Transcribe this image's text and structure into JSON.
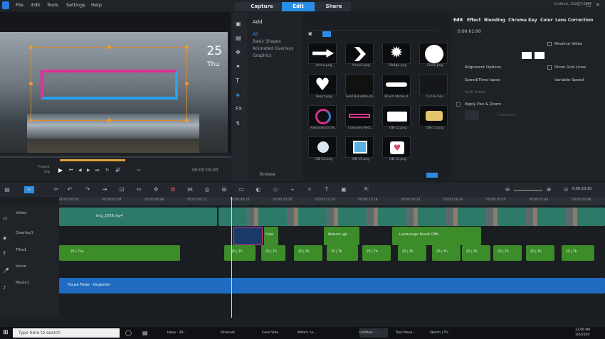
{
  "menu": {
    "file": "File",
    "edit": "Edit",
    "tools": "Tools",
    "settings": "Settings",
    "help": "Help"
  },
  "modes": {
    "capture": "Capture",
    "edit": "Edit",
    "share": "Share"
  },
  "window": {
    "title": "Untitled, 1920*1080*"
  },
  "preview": {
    "big_date": "25",
    "big_day": "Thu",
    "project_label": "Project",
    "clip_label": "Clip",
    "timecode": "00:00:00:00"
  },
  "library": {
    "add": "Add",
    "categories": [
      "All",
      "Basic Shapes",
      "Animated Overlays",
      "Graphics"
    ],
    "browse": "Browse",
    "thumbs": [
      "Arrow.png",
      "Arrow2.png",
      "Badge.png",
      "Circle.png",
      "Heart.png",
      "Gold Bokehbrush...",
      "Brush Stroke 4...",
      "Circle.mov",
      "Rainbow Circle...",
      "Coloured Rect...",
      "OB-12.png",
      "OB-13.png",
      "OB-14.png",
      "OB-15.png",
      "OB-16.png"
    ]
  },
  "options": {
    "tabs": [
      "Edit",
      "Effect",
      "Blending",
      "Chroma Key",
      "Color",
      "Lens Correction"
    ],
    "duration": "0:00:01:00",
    "reverse": "Reverse Video",
    "align": "Alignment Options",
    "grid": "Show Grid Lines",
    "timelapse": "Speed/Time-lapse",
    "variable": "Variable Speed",
    "split": "Split Audio",
    "panzoom": "Apply Pan & Zoom",
    "custom": "Customize"
  },
  "ruler": {
    "ticks": [
      "00:00:00:00",
      "00:00:02:04",
      "00:00:04:08",
      "00:00:06:12",
      "00:00:08:16",
      "00:00:10:20",
      "00:00:12:24",
      "00:00:14:28",
      "00:00:16:32",
      "00:00:18:36",
      "00:00:20:40",
      "00:00:22:44",
      "00:00:24:48"
    ]
  },
  "timeline_zoom": "0:00:23:20",
  "tracks": {
    "video": "Video",
    "overlay": "Overlay1",
    "title": "Title1",
    "voice": "Voice",
    "music": "Music1"
  },
  "clips": {
    "video_main": "img_2058.mp4",
    "overlay_a": "Color",
    "overlay_b": "Malarrd Lgh",
    "overlay_c": "Lumbranger Basalt Cliffs",
    "title": "25 | Thu",
    "title_short": "25 | Th",
    "music": "House Fever - Organism"
  },
  "taskbar": {
    "search": "Type here to search",
    "apps": [
      "Inbox - ZK...",
      "Pinterest",
      "Corel Vide...",
      "What's ne...",
      "Untitled - ...",
      "Task Mana...",
      "Sketch | Th..."
    ],
    "time": "12:06 PM",
    "date": "3/4/2020"
  }
}
